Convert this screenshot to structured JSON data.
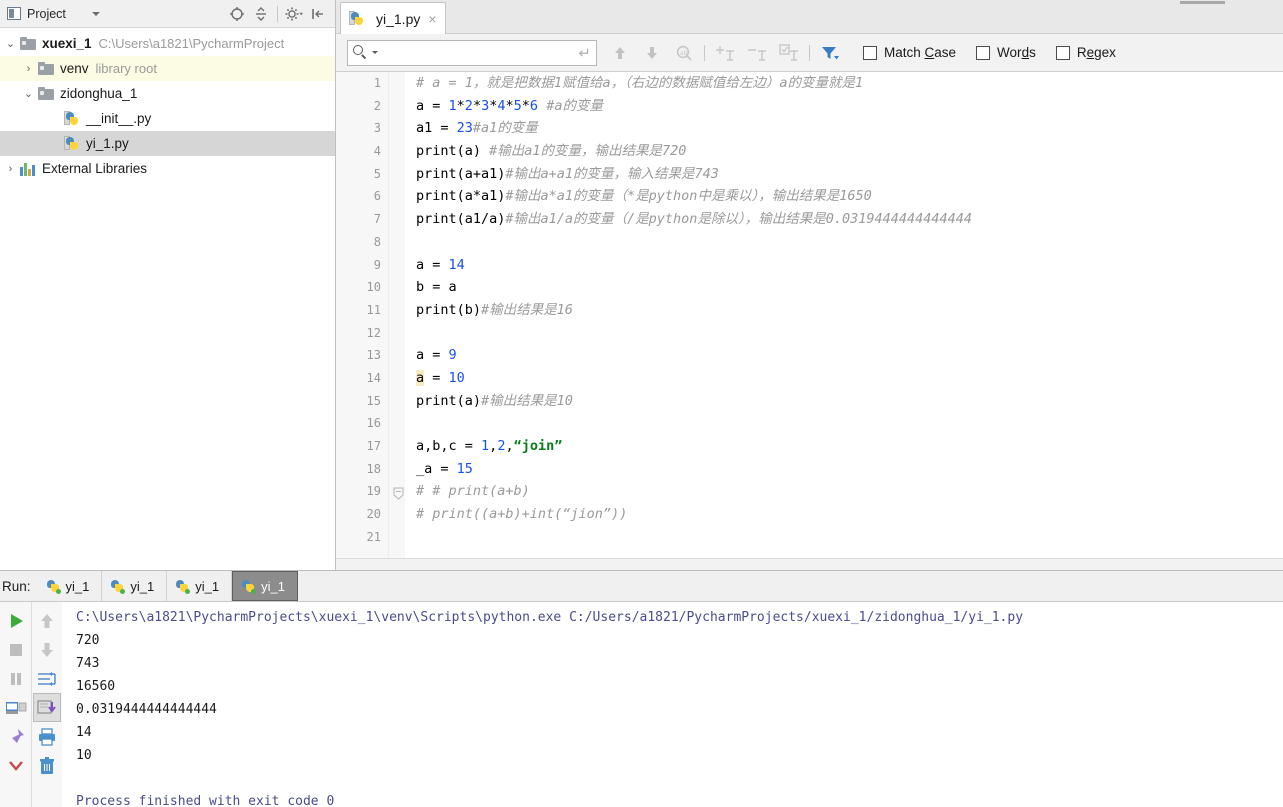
{
  "project_panel": {
    "title": "Project",
    "icons": {
      "project_icon": "project-view-icon",
      "locate": "locate-file-icon",
      "collapse_all": "collapse-all-icon",
      "settings": "gear-icon",
      "hide": "hide-panel-icon"
    },
    "tree": [
      {
        "label": "xuexi_1",
        "sub": "C:\\Users\\a1821\\PycharmProject",
        "arrow": "⌄",
        "depth": 0,
        "kind": "folder",
        "bold": true,
        "selected": false,
        "libroot": false,
        "name": "tree-node-xuexi-1"
      },
      {
        "label": "venv",
        "sub": "library root",
        "arrow": "›",
        "depth": 1,
        "kind": "folder",
        "bold": false,
        "selected": false,
        "libroot": true,
        "name": "tree-node-venv"
      },
      {
        "label": "zidonghua_1",
        "sub": "",
        "arrow": "⌄",
        "depth": 1,
        "kind": "folder",
        "bold": false,
        "selected": false,
        "libroot": false,
        "name": "tree-node-zidonghua-1"
      },
      {
        "label": "__init__.py",
        "sub": "",
        "arrow": "",
        "depth": 2,
        "kind": "python",
        "bold": false,
        "selected": false,
        "libroot": false,
        "name": "tree-node-init-py"
      },
      {
        "label": "yi_1.py",
        "sub": "",
        "arrow": "",
        "depth": 2,
        "kind": "python",
        "bold": false,
        "selected": true,
        "libroot": false,
        "name": "tree-node-yi-1-py"
      },
      {
        "label": "External Libraries",
        "sub": "",
        "arrow": "›",
        "depth": 0,
        "kind": "library",
        "bold": false,
        "selected": false,
        "libroot": false,
        "name": "tree-node-external-libraries"
      }
    ]
  },
  "editor": {
    "tab": {
      "label": "yi_1.py",
      "close": "×"
    },
    "find": {
      "value": "",
      "placeholder": "",
      "enter_glyph": "↵",
      "options": [
        {
          "label_pre": "Match ",
          "label_u": "C",
          "label_post": "ase",
          "checked": false,
          "name": "match-case-checkbox"
        },
        {
          "label_pre": "Wor",
          "label_u": "d",
          "label_post": "s",
          "checked": false,
          "name": "words-checkbox"
        },
        {
          "label_pre": "R",
          "label_u": "e",
          "label_post": "gex",
          "checked": false,
          "name": "regex-checkbox"
        }
      ]
    },
    "lines": [
      {
        "n": "1",
        "html": "<span class='cm'># a = 1，就是把数据1赋值给a，（右边的数据赋值给左边）a的变量就是1</span>"
      },
      {
        "n": "2",
        "html": "a = <span class='num'>1</span>*<span class='num'>2</span>*<span class='num'>3</span>*<span class='num'>4</span>*<span class='num'>5</span>*<span class='num'>6</span> <span class='cm'>#a的变量</span>"
      },
      {
        "n": "3",
        "html": "a1 = <span class='num'>23</span><span class='cm'>#a1的变量</span>"
      },
      {
        "n": "4",
        "html": "print(a) <span class='cm'>#输出a1的变量，输出结果是720</span>"
      },
      {
        "n": "5",
        "html": "print(a+a1)<span class='cm'>#输出a+a1的变量，输入结果是743</span>"
      },
      {
        "n": "6",
        "html": "print(a*a1)<span class='cm'>#输出a*a1的变量（*是python中是乘以），输出结果是1650</span>"
      },
      {
        "n": "7",
        "html": "print(a1/a)<span class='cm'>#输出a1/a的变量（/是python是除以），输出结果是0.0319444444444444</span>"
      },
      {
        "n": "8",
        "html": ""
      },
      {
        "n": "9",
        "html": "a = <span class='num'>14</span>"
      },
      {
        "n": "10",
        "html": "b = a"
      },
      {
        "n": "11",
        "html": "print(b)<span class='cm'>#输出结果是16</span>"
      },
      {
        "n": "12",
        "html": ""
      },
      {
        "n": "13",
        "html": "a = <span class='num'>9</span>"
      },
      {
        "n": "14",
        "html": "<span class='hl'>a</span> = <span class='num'>10</span>"
      },
      {
        "n": "15",
        "html": "print(a)<span class='cm'>#输出结果是10</span>"
      },
      {
        "n": "16",
        "html": ""
      },
      {
        "n": "17",
        "html": "a,b,c = <span class='num'>1</span>,<span class='num'>2</span>,<span class='str'>“join”</span>"
      },
      {
        "n": "18",
        "html": "_a = <span class='num'>15</span>"
      },
      {
        "n": "19",
        "html": "<span class='cm'># # print(a+b)</span>"
      },
      {
        "n": "20",
        "html": "<span class='cm'># print((a+b)+int(“jion”))</span>"
      },
      {
        "n": "21",
        "html": ""
      }
    ]
  },
  "run_panel": {
    "run_label": "Run:",
    "tabs": [
      {
        "label": "yi_1",
        "active": false,
        "name": "run-tab-yi-1-a"
      },
      {
        "label": "yi_1",
        "active": false,
        "name": "run-tab-yi-1-b"
      },
      {
        "label": "yi_1",
        "active": false,
        "name": "run-tab-yi-1-c"
      },
      {
        "label": "yi_1",
        "active": true,
        "name": "run-tab-yi-1-d"
      }
    ],
    "side_icons_col1": [
      "run-icon",
      "stop-icon",
      "pause-icon",
      "restore-layout-icon",
      "pin-icon",
      "chevron-down-icon"
    ],
    "side_icons_col2": [
      "arrow-up-icon",
      "arrow-down-icon",
      "soft-wrap-icon",
      "scroll-to-end-icon",
      "print-icon",
      "trash-icon"
    ],
    "console": [
      {
        "text": "C:\\Users\\a1821\\PycharmProjects\\xuexi_1\\venv\\Scripts\\python.exe C:/Users/a1821/PycharmProjects/xuexi_1/zidonghua_1/yi_1.py",
        "kind": "cmd"
      },
      {
        "text": "720",
        "kind": "out"
      },
      {
        "text": "743",
        "kind": "out"
      },
      {
        "text": "16560",
        "kind": "out"
      },
      {
        "text": "0.0319444444444444",
        "kind": "out"
      },
      {
        "text": "14",
        "kind": "out"
      },
      {
        "text": "10",
        "kind": "out"
      },
      {
        "text": " ",
        "kind": "blank"
      },
      {
        "text": "Process finished with exit code 0",
        "kind": "done"
      }
    ]
  },
  "colors": {
    "selection": "#d6d6d6",
    "library_root": "#fcfbe3",
    "keyword_number": "#1750eb",
    "string": "#067d17",
    "comment": "#9a9a9a",
    "identifier_highlight": "#f7ecbf",
    "active_run_tab": "#8c8c8c",
    "console_text": "#4b4b8f"
  }
}
